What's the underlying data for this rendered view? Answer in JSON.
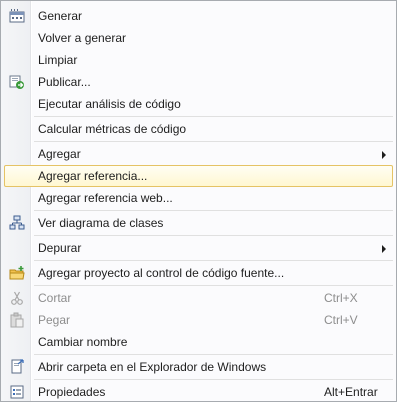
{
  "menu": {
    "items": [
      {
        "label": "Generar",
        "icon": "build-icon"
      },
      {
        "label": "Volver a generar"
      },
      {
        "label": "Limpiar"
      },
      {
        "label": "Publicar...",
        "icon": "publish-icon"
      },
      {
        "label": "Ejecutar análisis de código"
      },
      {
        "label": "Calcular métricas de código"
      },
      {
        "label": "Agregar",
        "submenu": true
      },
      {
        "label": "Agregar referencia...",
        "highlighted": true
      },
      {
        "label": "Agregar referencia web..."
      },
      {
        "label": "Ver diagrama de clases",
        "icon": "class-diagram-icon"
      },
      {
        "label": "Depurar",
        "submenu": true
      },
      {
        "label": "Agregar proyecto al control de código fuente...",
        "icon": "source-control-folder-icon"
      },
      {
        "label": "Cortar",
        "shortcut": "Ctrl+X",
        "disabled": true,
        "icon": "scissors-icon"
      },
      {
        "label": "Pegar",
        "shortcut": "Ctrl+V",
        "disabled": true,
        "icon": "clipboard-icon"
      },
      {
        "label": "Cambiar nombre"
      },
      {
        "label": "Abrir carpeta en el Explorador de Windows",
        "icon": "open-folder-icon"
      },
      {
        "label": "Propiedades",
        "shortcut": "Alt+Entrar",
        "icon": "properties-icon"
      }
    ]
  },
  "colors": {
    "highlight_border": "#e5c365",
    "highlight_fill": "#fff7d1",
    "disabled_text": "#8d8d8d"
  }
}
